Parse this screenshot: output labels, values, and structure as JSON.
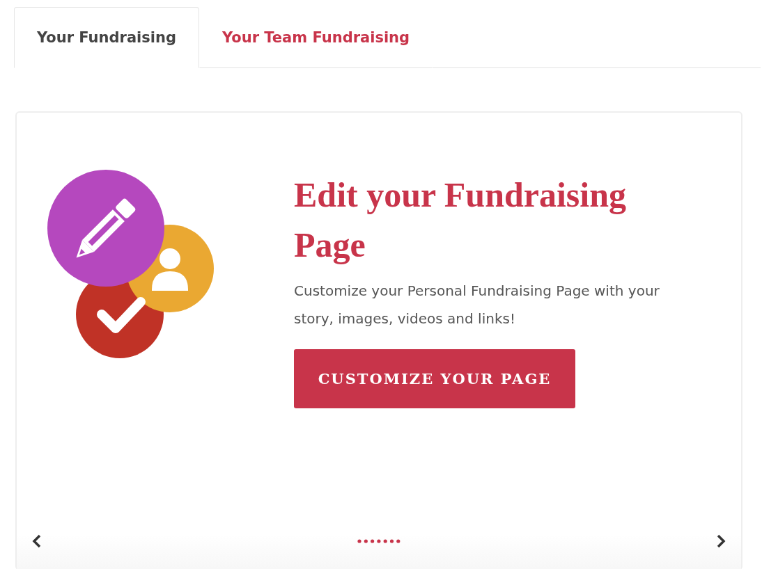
{
  "tabs": [
    {
      "label": "Your Fundraising",
      "selected": true
    },
    {
      "label": "Your Team Fundraising",
      "selected": false
    }
  ],
  "slide": {
    "title": "Edit your Fundraising Page",
    "text": "Customize your Personal Fundraising Page with your story, images, videos and links!",
    "button": "CUSTOMIZE YOUR PAGE"
  }
}
